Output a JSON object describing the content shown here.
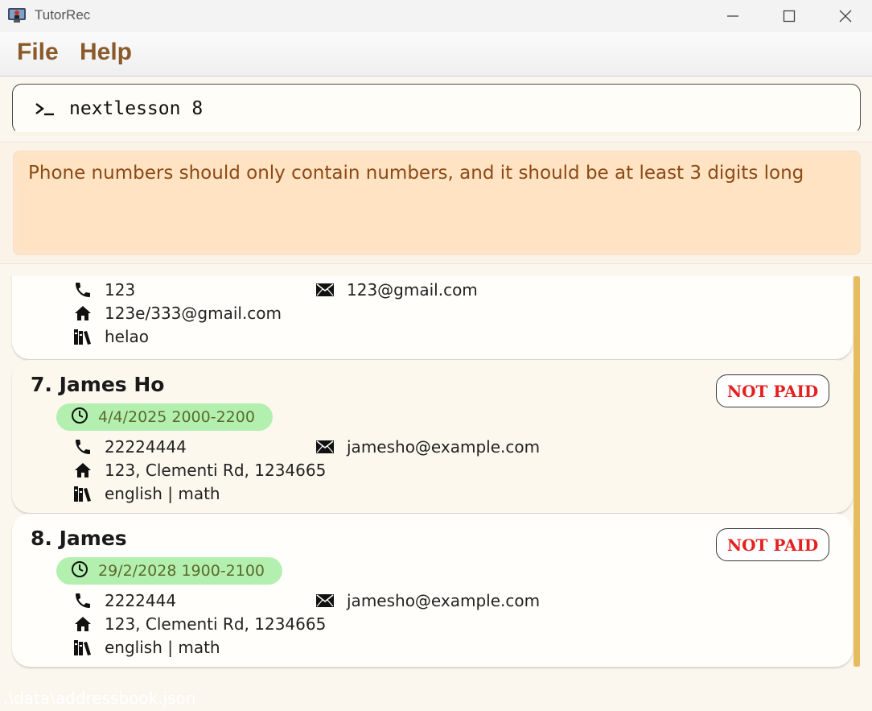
{
  "window": {
    "title": "TutorRec"
  },
  "menu": {
    "file": "File",
    "help": "Help"
  },
  "command": {
    "value": "nextlesson 8"
  },
  "result": {
    "message": "Phone numbers should only contain numbers, and it should be at least 3 digits long"
  },
  "persons": [
    {
      "phone": "123",
      "email": "123@gmail.com",
      "address": "123e/333@gmail.com",
      "subjects": "helao"
    },
    {
      "name": "7. James Ho",
      "lesson": "4/4/2025 2000-2200",
      "phone": "22224444",
      "email": "jamesho@example.com",
      "address": "123, Clementi Rd, 1234665",
      "subjects": "english | math",
      "status": "NOT PAID"
    },
    {
      "name": "8. James",
      "lesson": "29/2/2028 1900-2100",
      "phone": "2222444",
      "email": "jamesho@example.com",
      "address": "123, Clementi Rd, 1234665",
      "subjects": "english | math",
      "status": "NOT PAID"
    }
  ],
  "status": {
    "path": ".\\data\\addressbook.json"
  },
  "icons": {
    "phone": "phone-icon",
    "email": "envelope-icon",
    "address": "home-icon",
    "subjects": "books-icon",
    "lesson": "clock-icon"
  },
  "colors": {
    "menu": "#8b5a2b",
    "result_bg": "#ffe3c3",
    "lesson_bg": "#b3f0b0",
    "not_paid": "#e52020",
    "scrollbar": "#e5bd5f"
  }
}
